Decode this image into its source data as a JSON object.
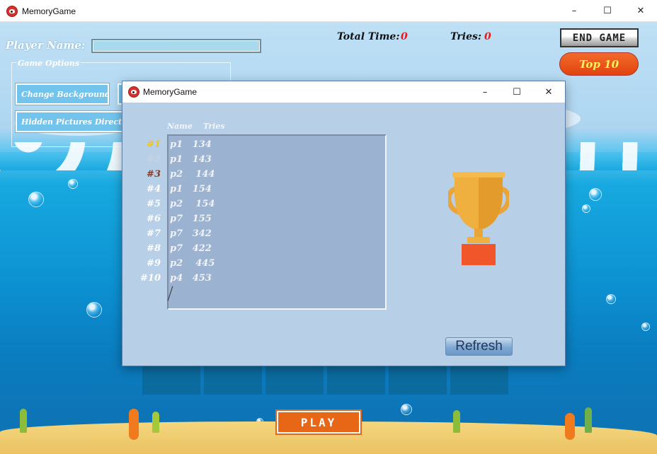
{
  "main_window": {
    "title": "MemoryGame",
    "app_icon": "memory-game-icon",
    "controls": {
      "minimize": "–",
      "maximize": "☐",
      "close": "✕"
    }
  },
  "header": {
    "player_name_label": "Player Name:",
    "player_name_value": "",
    "total_time_label": "Total Time:",
    "total_time_value": "0",
    "tries_label": "Tries:",
    "tries_value": "0",
    "end_game_label": "END GAME",
    "top10_label": "Top 10"
  },
  "game_options": {
    "title": "Game Options",
    "change_background_label": "Change Background",
    "hidden_pictures_label": "Hidden Pictures Directory"
  },
  "play_label": "PLAY",
  "dialog": {
    "title": "MemoryGame",
    "controls": {
      "minimize": "–",
      "maximize": "☐",
      "close": "✕"
    },
    "column_name": "Name",
    "column_tries": "Tries",
    "ranks": [
      "#1",
      "#2",
      "#3",
      "#4",
      "#5",
      "#6",
      "#7",
      "#8",
      "#9",
      "#10"
    ],
    "rank_colors": [
      "#f0c419",
      "#c6d3e3",
      "#8b3a1e",
      "#ffffff",
      "#ffffff",
      "#ffffff",
      "#ffffff",
      "#ffffff",
      "#ffffff",
      "#ffffff"
    ],
    "entries": [
      "p1   134",
      "p1   143",
      "p2    144",
      "p1   154",
      "p2    154",
      "p7   155",
      "p7   342",
      "p7   422",
      "p2    445",
      "p4   453"
    ],
    "trophy_icon": "trophy-icon",
    "refresh_label": "Refresh"
  }
}
